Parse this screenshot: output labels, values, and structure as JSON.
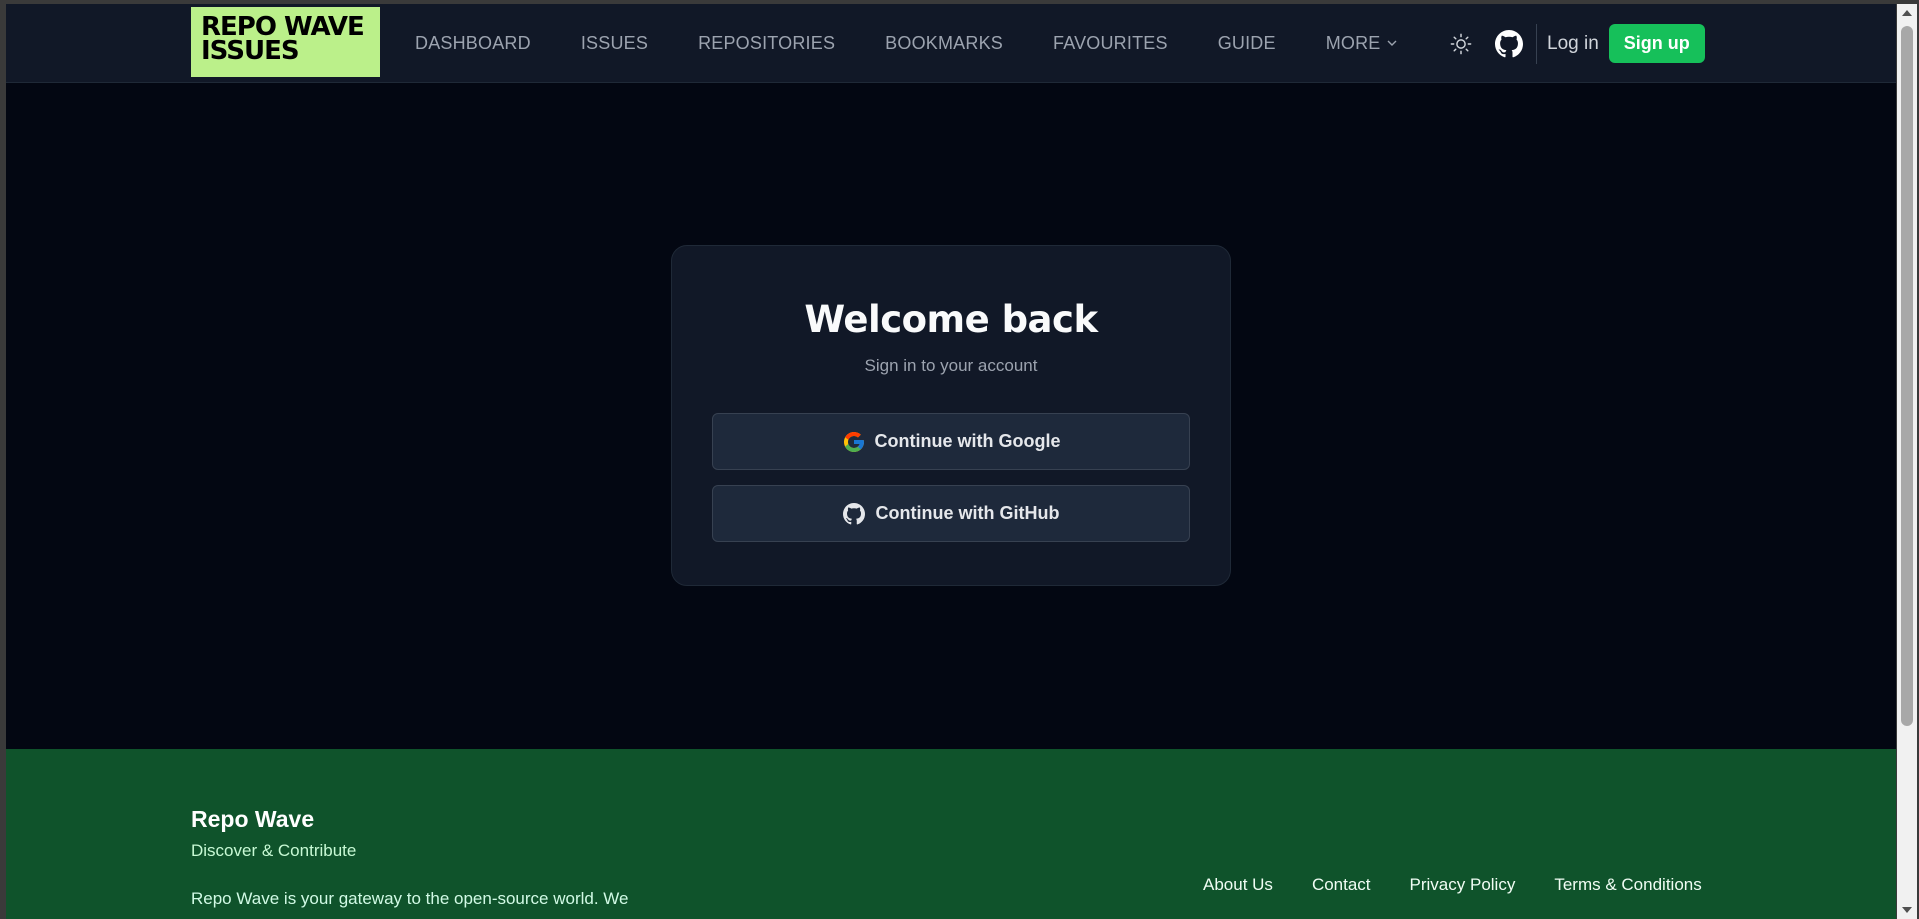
{
  "header": {
    "logo_line1": "REPO WAVE",
    "logo_line2": "ISSUES",
    "nav": [
      {
        "label": "DASHBOARD"
      },
      {
        "label": "ISSUES"
      },
      {
        "label": "REPOSITORIES"
      },
      {
        "label": "BOOKMARKS"
      },
      {
        "label": "FAVOURITES"
      },
      {
        "label": "GUIDE"
      },
      {
        "label": "MORE"
      }
    ],
    "theme_icon": "sun-icon",
    "github_icon": "github-icon",
    "login_label": "Log in",
    "signup_label": "Sign up"
  },
  "auth_card": {
    "title": "Welcome back",
    "subtitle": "Sign in to your account",
    "google_label": "Continue with Google",
    "github_label": "Continue with GitHub"
  },
  "footer": {
    "brand": "Repo Wave",
    "tagline": "Discover & Contribute",
    "description": "Repo Wave is your gateway to the open-source world. We",
    "links": [
      {
        "label": "About Us"
      },
      {
        "label": "Contact"
      },
      {
        "label": "Privacy Policy"
      },
      {
        "label": "Terms & Conditions"
      }
    ]
  },
  "colors": {
    "page_bg": "#030712",
    "header_bg": "#111827",
    "logo_bg": "#bbf08a",
    "accent": "#16c05a",
    "footer_bg": "#0f532b"
  }
}
